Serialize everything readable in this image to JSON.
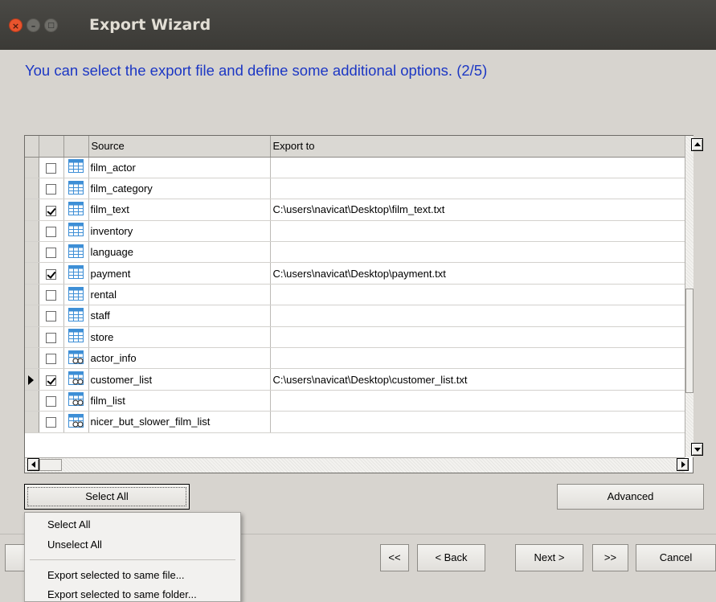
{
  "window": {
    "title": "Export Wizard",
    "controls": {
      "close": "×",
      "minimize": "–",
      "maximize": "□"
    }
  },
  "instruction": "You can select the export file and define some additional options. (2/5)",
  "grid": {
    "headers": {
      "source": "Source",
      "export_to": "Export to"
    },
    "rows": [
      {
        "checked": false,
        "current": false,
        "icon": "table-icon",
        "source": "film_actor",
        "export_to": ""
      },
      {
        "checked": false,
        "current": false,
        "icon": "table-icon",
        "source": "film_category",
        "export_to": ""
      },
      {
        "checked": true,
        "current": false,
        "icon": "table-icon",
        "source": "film_text",
        "export_to": "C:\\users\\navicat\\Desktop\\film_text.txt"
      },
      {
        "checked": false,
        "current": false,
        "icon": "table-icon",
        "source": "inventory",
        "export_to": ""
      },
      {
        "checked": false,
        "current": false,
        "icon": "table-icon",
        "source": "language",
        "export_to": ""
      },
      {
        "checked": true,
        "current": false,
        "icon": "table-icon",
        "source": "payment",
        "export_to": "C:\\users\\navicat\\Desktop\\payment.txt"
      },
      {
        "checked": false,
        "current": false,
        "icon": "table-icon",
        "source": "rental",
        "export_to": ""
      },
      {
        "checked": false,
        "current": false,
        "icon": "table-icon",
        "source": "staff",
        "export_to": ""
      },
      {
        "checked": false,
        "current": false,
        "icon": "table-icon",
        "source": "store",
        "export_to": ""
      },
      {
        "checked": false,
        "current": false,
        "icon": "view-icon",
        "source": "actor_info",
        "export_to": ""
      },
      {
        "checked": true,
        "current": true,
        "icon": "view-icon",
        "source": "customer_list",
        "export_to": "C:\\users\\navicat\\Desktop\\customer_list.txt"
      },
      {
        "checked": false,
        "current": false,
        "icon": "view-icon",
        "source": "film_list",
        "export_to": ""
      },
      {
        "checked": false,
        "current": false,
        "icon": "view-icon",
        "source": "nicer_but_slower_film_list",
        "export_to": ""
      }
    ]
  },
  "buttons": {
    "select_all": "Select All",
    "advanced": "Advanced",
    "first": "<<",
    "back": "< Back",
    "next": "Next >",
    "last": ">>",
    "cancel": "Cancel"
  },
  "popup_menu": {
    "items": [
      "Select All",
      "Unselect All",
      "Export selected to same file...",
      "Export selected to same folder..."
    ]
  },
  "colors": {
    "instruction": "#1c37c4",
    "titlebar": "#3c3b37",
    "close_button": "#e9542d",
    "table_icon": "#3e8fd6"
  }
}
